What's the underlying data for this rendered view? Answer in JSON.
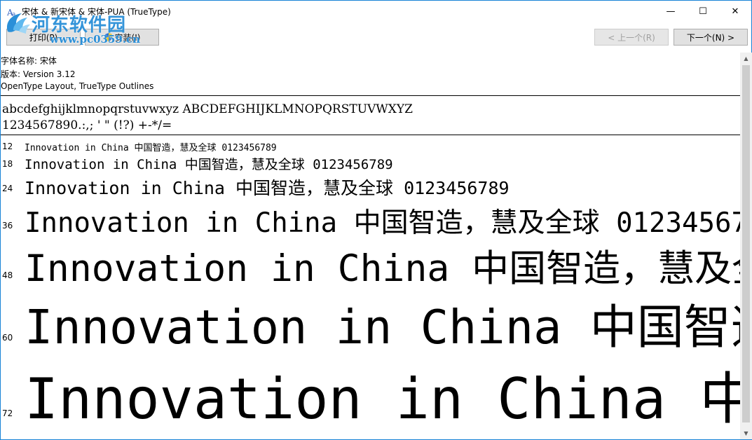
{
  "window": {
    "title": "宋体 & 新宋体 & 宋体-PUA  (TrueType)",
    "minimize_glyph": "—",
    "maximize_glyph": "☐",
    "close_glyph": "✕"
  },
  "watermark": {
    "title": "河东软件园",
    "url": "www.pc0359.cn"
  },
  "toolbar": {
    "print_label": "打印(P)",
    "install_label": "安装(I)",
    "prev_label": "< 上一个(R)",
    "next_label": "下一个(N) >"
  },
  "font_info": {
    "name_line": "字体名称: 宋体",
    "version_line": "版本: Version 3.12",
    "outline_line": "OpenType Layout, TrueType Outlines"
  },
  "charset": {
    "letters": "abcdefghijklmnopqrstuvwxyz ABCDEFGHIJKLMNOPQRSTUVWXYZ",
    "digits": "1234567890.:,; ' \" (!?) +-*/="
  },
  "samples": {
    "text": "Innovation in China 中国智造，慧及全球 0123456789",
    "rows": [
      {
        "size": "12"
      },
      {
        "size": "18"
      },
      {
        "size": "24"
      },
      {
        "size": "36"
      },
      {
        "size": "48"
      },
      {
        "size": "60"
      },
      {
        "size": "72"
      }
    ]
  },
  "colors": {
    "window_border": "#1883d7",
    "watermark": "#2a8fd8",
    "disabled_text": "#a0a0a0"
  },
  "icons": {
    "app": "font-file-icon",
    "shield": "uac-shield-icon"
  }
}
